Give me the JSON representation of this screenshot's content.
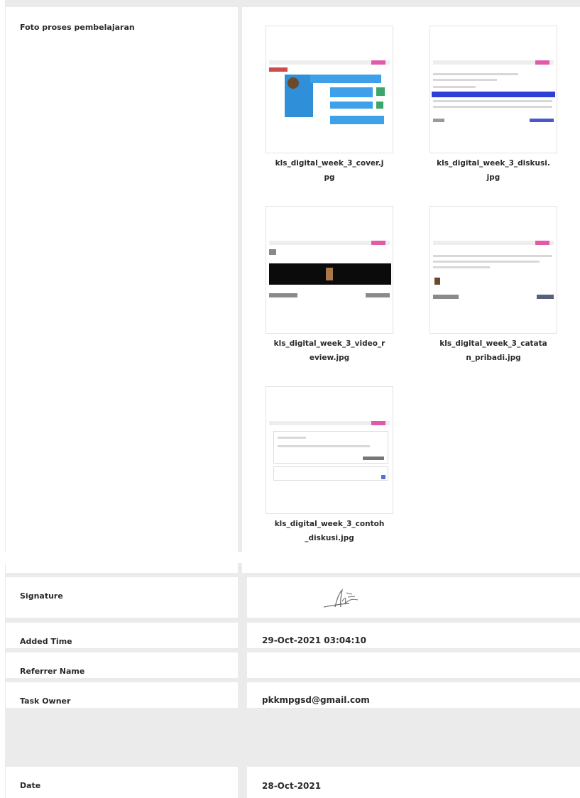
{
  "photos": {
    "label": "Foto proses pembelajaran",
    "files": [
      {
        "line1": "kls_digital_week_3_cover.j",
        "line2": "pg"
      },
      {
        "line1": "kls_digital_week_3_diskusi.",
        "line2": "jpg"
      },
      {
        "line1": "kls_digital_week_3_video_r",
        "line2": "eview.jpg"
      },
      {
        "line1": "kls_digital_week_3_catata",
        "line2": "n_pribadi.jpg"
      },
      {
        "line1": "kls_digital_week_3_contoh",
        "line2": "_diskusi.jpg"
      }
    ]
  },
  "signature": {
    "label": "Signature"
  },
  "added_time": {
    "label": "Added Time",
    "value": "29-Oct-2021 03:04:10"
  },
  "referrer_name": {
    "label": "Referrer Name",
    "value": ""
  },
  "task_owner": {
    "label": "Task Owner",
    "value": "pkkmpgsd@gmail.com"
  },
  "date": {
    "label": "Date",
    "value": "28-Oct-2021"
  }
}
